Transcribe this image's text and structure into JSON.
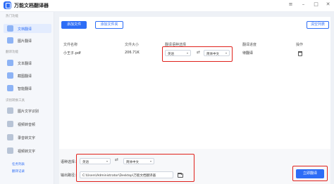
{
  "app": {
    "title": "万能文档翻译器"
  },
  "sidebar": {
    "groups": [
      {
        "title": "热门功能"
      },
      {
        "title": "翻译功能"
      },
      {
        "title": "识别转换工具"
      }
    ],
    "items": [
      {
        "label": "文档翻译",
        "icon": "document-translate-icon",
        "active": true
      },
      {
        "label": "图片翻译",
        "icon": "image-translate-icon"
      },
      {
        "label": "文本翻译",
        "icon": "text-translate-icon"
      },
      {
        "label": "截图翻译",
        "icon": "screenshot-translate-icon"
      },
      {
        "label": "智能翻译",
        "icon": "smart-translate-icon"
      },
      {
        "label": "图片文字识别",
        "icon": "ocr-icon"
      },
      {
        "label": "视频转音频",
        "icon": "video-to-audio-icon"
      },
      {
        "label": "录音转文字",
        "icon": "recording-to-text-icon"
      },
      {
        "label": "视频转文字",
        "icon": "video-to-text-icon"
      }
    ],
    "footer": {
      "tasks": "任务列表",
      "records": "翻译记录"
    }
  },
  "toolbar": {
    "add_file": "添加文件",
    "add_folder": "添加文件夹",
    "clear_list": "清空列表"
  },
  "table": {
    "headers": [
      "文件名称",
      "文件大小",
      "翻译语种选择",
      "翻译进度",
      "操作"
    ],
    "rows": [
      {
        "name": "小王子.pdf",
        "size": "206.71K",
        "src_lang": "英语",
        "dst_lang": "简体中文",
        "status": "待翻译"
      }
    ]
  },
  "bottom": {
    "lang_label": "语种选择：",
    "src_lang": "英语",
    "dst_lang": "简体中文",
    "path_label": "输出路径：",
    "path_value": "C:\\Users\\Administrator\\Desktop\\万能文档翻译器",
    "start": "立即翻译"
  },
  "colors": {
    "accent": "#2d6df6",
    "highlight": "#e0211b"
  }
}
